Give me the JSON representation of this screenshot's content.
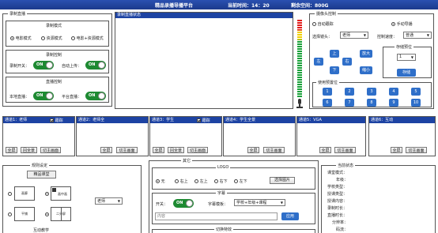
{
  "header": {
    "title": "精品录播导播平台",
    "time_label": "当前时间：14：20",
    "space_label": "剩余空间：800G"
  },
  "record_settings": {
    "legend": "录制直播",
    "mode_title": "录制模式",
    "modes": [
      "电影模式",
      "资源模式",
      "电影+资源模式"
    ],
    "selected_mode": 0,
    "control_title": "录制控制",
    "record_switch_label": "录制开关：",
    "auto_upload_label": "自动上传：",
    "live_title": "直播控制",
    "local_live_label": "本地直播：",
    "platform_live_label": "平台直播：",
    "toggle_on": "ON"
  },
  "preview": {
    "title": "录制直播状态"
  },
  "camera_control": {
    "legend": "摄像头控制",
    "auto_track": "自动跟踪",
    "manual_director": "手动导播",
    "select_camera_label": "选择镜头：",
    "select_camera_value": "老师",
    "speed_label": "控制速度：",
    "speed_value": "普通",
    "dir_up": "上",
    "dir_left": "左",
    "dir_right": "右",
    "dir_down": "下",
    "zoom_in": "放大",
    "zoom_out": "缩小",
    "preset_legend": "存储预位",
    "preset_value": "1",
    "save_button": "存储",
    "use_preset_legend": "使用预置位",
    "presets": [
      "1",
      "2",
      "3",
      "4",
      "5",
      "6",
      "7",
      "8",
      "9",
      "10"
    ]
  },
  "channels": [
    {
      "title": "通道1：老师",
      "follow": "跟踪",
      "buttons": [
        "全屏",
        "回全景",
        "切主画面"
      ]
    },
    {
      "title": "通道2：老师全",
      "buttons": [
        "全屏",
        "切主画面"
      ]
    },
    {
      "title": "通道3：学生",
      "follow": "跟踪",
      "buttons": [
        "全屏",
        "回全景",
        "切主画面"
      ]
    },
    {
      "title": "通道4：学生全景",
      "buttons": [
        "全屏",
        "切主画面"
      ]
    },
    {
      "title": "通道5：VGA",
      "buttons": [
        "全屏",
        "切主画面"
      ]
    },
    {
      "title": "通道6：互动",
      "buttons": [
        "全屏",
        "切主画面"
      ]
    }
  ],
  "layout_panel": {
    "legend": "规则设定",
    "course_button": "精品课堂",
    "layouts": [
      "画廊",
      "画中画",
      "平铺",
      "二分屏"
    ],
    "camera_select": "老师",
    "interactive_label": "互动教学"
  },
  "other_panel": {
    "legend": "其它",
    "logo_title": "LOGO",
    "logo_positions": [
      "无",
      "右上",
      "左上",
      "右下",
      "左下"
    ],
    "selected_logo": 0,
    "choose_image": "选择图片",
    "subtitle_title": "字幕",
    "switch_label": "开关：",
    "template_label": "字幕模板：",
    "template_value": "学校+年级+课程",
    "content_placeholder": "内容",
    "apply_button": "应用",
    "transition_title": "切换特效"
  },
  "status_panel": {
    "legend": "当前状态",
    "fields": [
      "课堂模式：",
      "年级：",
      "学校类型：",
      "授课类型：",
      "授课内容：",
      "录制时长：",
      "直播时长：",
      "分辨率：",
      "码流："
    ]
  }
}
